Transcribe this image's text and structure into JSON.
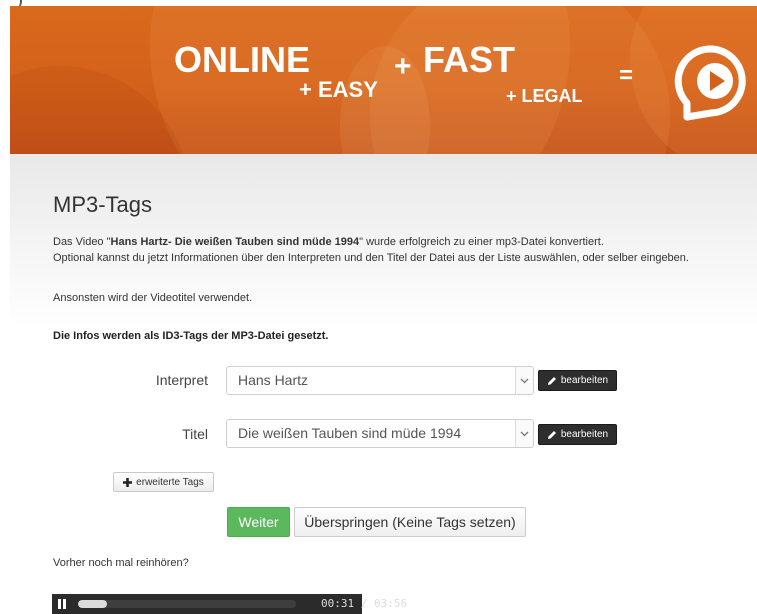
{
  "banner": {
    "slogan_online": "ONLINE",
    "slogan_easy": "+ EASY",
    "slogan_plus": "+",
    "slogan_fast": "FAST",
    "slogan_legal": "+ LEGAL",
    "slogan_equals": "=",
    "logo_icon": "play-circle-icon",
    "colors": {
      "background": "#d4611a",
      "text": "#ffffff"
    }
  },
  "main": {
    "title": "MP3-Tags",
    "p1_prefix": "Das Video \"",
    "p1_video": "Hans Hartz- Die weißen Tauben sind müde 1994",
    "p1_suffix": "\" wurde erfolgreich zu einer mp3-Datei konvertiert.",
    "p2": "Optional kannst du jetzt Informationen über den Interpreten und den Titel der Datei aus der Liste auswählen, oder selber eingeben.",
    "p3": "Ansonsten wird der Videotitel verwendet.",
    "info": "Die Infos werden als ID3-Tags der MP3-Datei gesetzt."
  },
  "form": {
    "interpret_label": "Interpret",
    "interpret_value": "Hans Hartz",
    "titel_label": "Titel",
    "titel_value": "Die weißen Tauben sind müde 1994",
    "edit_label": "bearbeiten",
    "extended_tags_label": "erweiterte Tags",
    "weiter_label": "Weiter",
    "skip_label": "Überspringen (Keine Tags setzen)",
    "colors": {
      "weiter": "#5cb85c",
      "edit": "#2e2e2e"
    }
  },
  "preview": {
    "hint": "Vorher noch mal reinhören?"
  },
  "player": {
    "current_time": "00:31",
    "separator": "/",
    "total_time": "03:56",
    "progress": 0.131
  }
}
